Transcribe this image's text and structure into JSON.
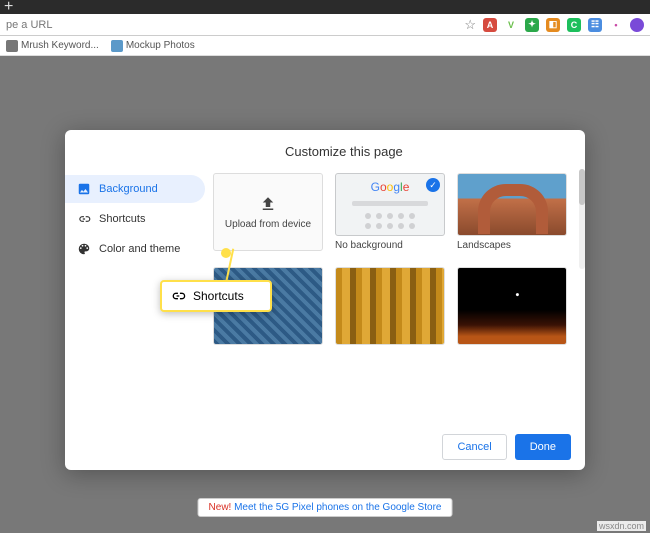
{
  "tabbar": {
    "plus": "+"
  },
  "address": {
    "placeholder": "pe a URL",
    "star": "☆"
  },
  "extensions": [
    {
      "name": "ext-red",
      "glyph": "A",
      "bg": "#d64b3f"
    },
    {
      "name": "ext-v",
      "glyph": "V",
      "bg": "#6abf4b"
    },
    {
      "name": "ext-evernote",
      "glyph": "🐘",
      "bg": "#2ba84a"
    },
    {
      "name": "ext-orange",
      "glyph": "⬧",
      "bg": "#e58b1f"
    },
    {
      "name": "ext-green-c",
      "glyph": "C",
      "bg": "#1dbf5c"
    },
    {
      "name": "ext-blue-sq",
      "glyph": "☷",
      "bg": "#4b8de0"
    },
    {
      "name": "ext-dot",
      "glyph": "•",
      "bg": "#c94aa7"
    },
    {
      "name": "ext-purple",
      "glyph": "●",
      "bg": "#7a4ad8"
    }
  ],
  "bookmarks": [
    {
      "label": "Mrush Keyword..."
    },
    {
      "label": "Mockup Photos"
    }
  ],
  "dialog": {
    "title": "Customize this page",
    "sidebar": {
      "background": "Background",
      "shortcuts": "Shortcuts",
      "color_theme": "Color and theme"
    },
    "gallery": {
      "upload": "Upload from device",
      "no_bg": "No background",
      "google": "Google",
      "landscapes": "Landscapes"
    },
    "footer": {
      "cancel": "Cancel",
      "done": "Done"
    }
  },
  "callout": {
    "label": "Shortcuts"
  },
  "promo": {
    "new": "New!",
    "text": " Meet the 5G Pixel phones on the Google Store"
  },
  "watermark": "wsxdn.com"
}
